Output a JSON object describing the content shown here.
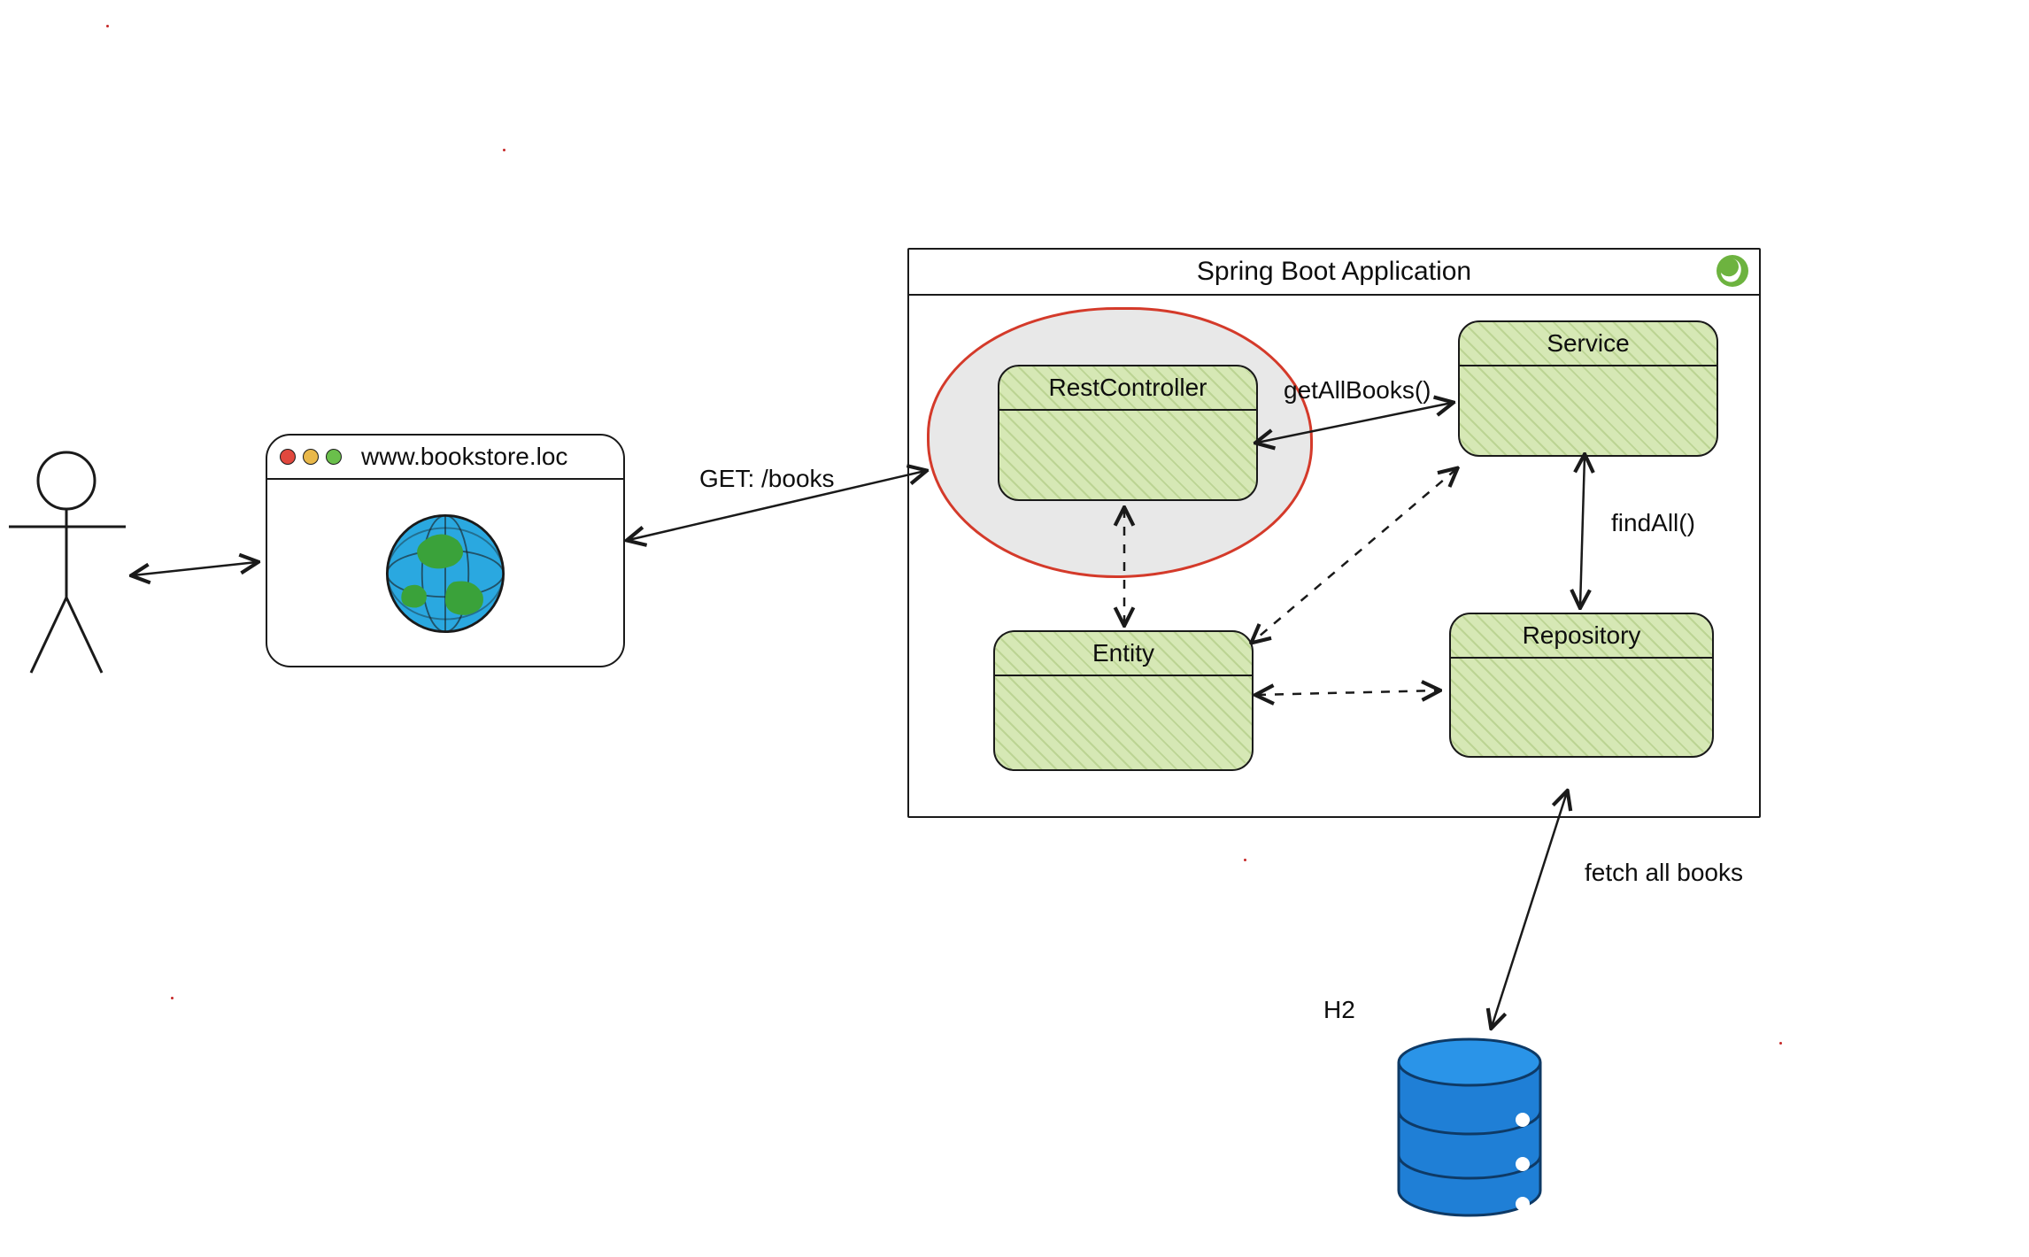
{
  "app": {
    "title": "Spring Boot Application",
    "logo_name": "spring-logo"
  },
  "browser": {
    "url": "www.bookstore.loc",
    "icon_name": "globe-icon"
  },
  "components": {
    "restcontroller": {
      "label": "RestController"
    },
    "service": {
      "label": "Service"
    },
    "entity": {
      "label": "Entity"
    },
    "repository": {
      "label": "Repository"
    }
  },
  "edges": {
    "browser_to_controller": "GET: /books",
    "controller_to_service": "getAllBooks()",
    "service_to_repository": "findAll()",
    "repository_to_db": "fetch all books"
  },
  "database": {
    "label": "H2"
  },
  "actor": {
    "name": "user"
  }
}
